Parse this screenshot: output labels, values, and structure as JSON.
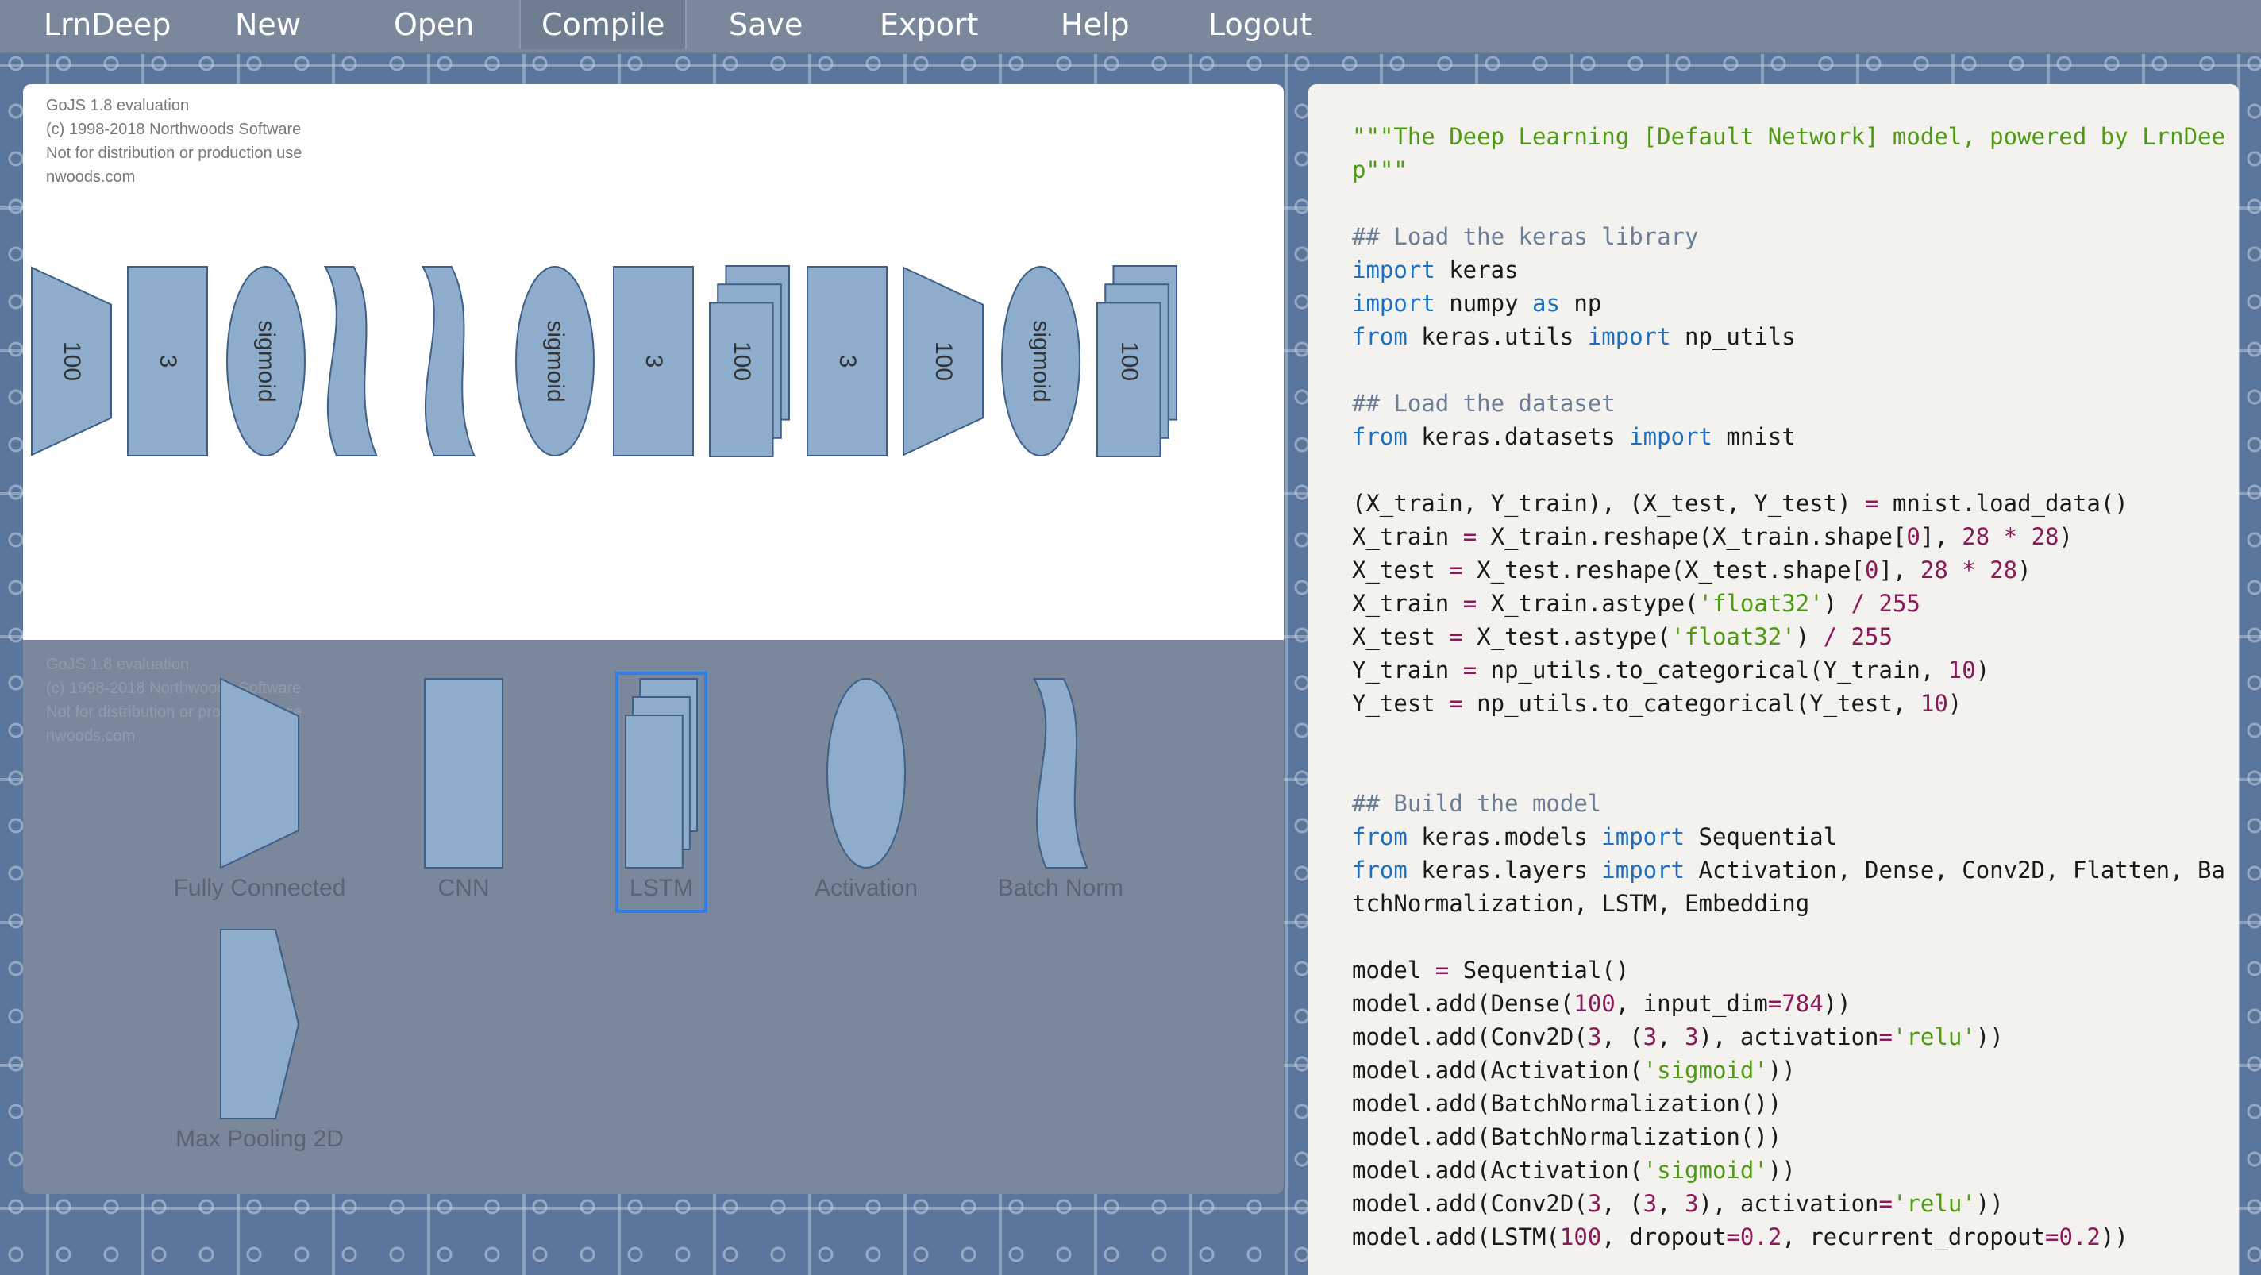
{
  "menu": {
    "brand": "LrnDeep",
    "items": [
      "New",
      "Open",
      "Compile",
      "Save",
      "Export",
      "Help",
      "Logout"
    ]
  },
  "diagram": {
    "eval_note": [
      "GoJS 1.8 evaluation",
      "(c) 1998-2018 Northwoods Software",
      "Not for distribution or production use",
      "nwoods.com"
    ],
    "nodes": [
      {
        "kind": "fully-connected",
        "label": "100"
      },
      {
        "kind": "cnn",
        "label": "3"
      },
      {
        "kind": "activation",
        "label": "sigmoid"
      },
      {
        "kind": "batch-norm",
        "label": ""
      },
      {
        "kind": "batch-norm",
        "label": ""
      },
      {
        "kind": "activation",
        "label": "sigmoid"
      },
      {
        "kind": "cnn",
        "label": "3"
      },
      {
        "kind": "lstm",
        "label": "100"
      },
      {
        "kind": "cnn",
        "label": "3"
      },
      {
        "kind": "fully-connected",
        "label": "100"
      },
      {
        "kind": "activation",
        "label": "sigmoid"
      },
      {
        "kind": "lstm",
        "label": "100"
      }
    ],
    "node_fill": "#8eadcc",
    "node_stroke": "#3f5f86"
  },
  "palette": {
    "ghost_note": [
      "GoJS 1.8 evaluation",
      "(c) 1998-2018 Northwoods Software",
      "Not for distribution or production use",
      "nwoods.com"
    ],
    "items": [
      {
        "kind": "fully-connected",
        "label": "Fully Connected"
      },
      {
        "kind": "cnn",
        "label": "CNN"
      },
      {
        "kind": "lstm",
        "label": "LSTM",
        "selected": true
      },
      {
        "kind": "activation",
        "label": "Activation"
      },
      {
        "kind": "batch-norm",
        "label": "Batch Norm"
      },
      {
        "kind": "max-pooling",
        "label": "Max Pooling 2D"
      }
    ],
    "selection_color": "#2f7fe8"
  },
  "code": {
    "lines": [
      "\"\"\"The Deep Learning [Default Network] model, powered by LrnDee",
      "p\"\"\"",
      "",
      "## Load the keras library",
      "import keras",
      "import numpy as np",
      "from keras.utils import np_utils",
      "",
      "## Load the dataset",
      "from keras.datasets import mnist",
      "",
      "(X_train, Y_train), (X_test, Y_test) = mnist.load_data()",
      "X_train = X_train.reshape(X_train.shape[0], 28 * 28)",
      "X_test = X_test.reshape(X_test.shape[0], 28 * 28)",
      "X_train = X_train.astype('float32') / 255",
      "X_test = X_test.astype('float32') / 255",
      "Y_train = np_utils.to_categorical(Y_train, 10)",
      "Y_test = np_utils.to_categorical(Y_test, 10)",
      "",
      "",
      "## Build the model",
      "from keras.models import Sequential",
      "from keras.layers import Activation, Dense, Conv2D, Flatten, Ba",
      "tchNormalization, LSTM, Embedding",
      "",
      "model = Sequential()",
      "model.add(Dense(100, input_dim=784))",
      "model.add(Conv2D(3, (3, 3), activation='relu'))",
      "model.add(Activation('sigmoid'))",
      "model.add(BatchNormalization())",
      "model.add(BatchNormalization())",
      "model.add(Activation('sigmoid'))",
      "model.add(Conv2D(3, (3, 3), activation='relu'))",
      "model.add(LSTM(100, dropout=0.2, recurrent_dropout=0.2))"
    ]
  }
}
